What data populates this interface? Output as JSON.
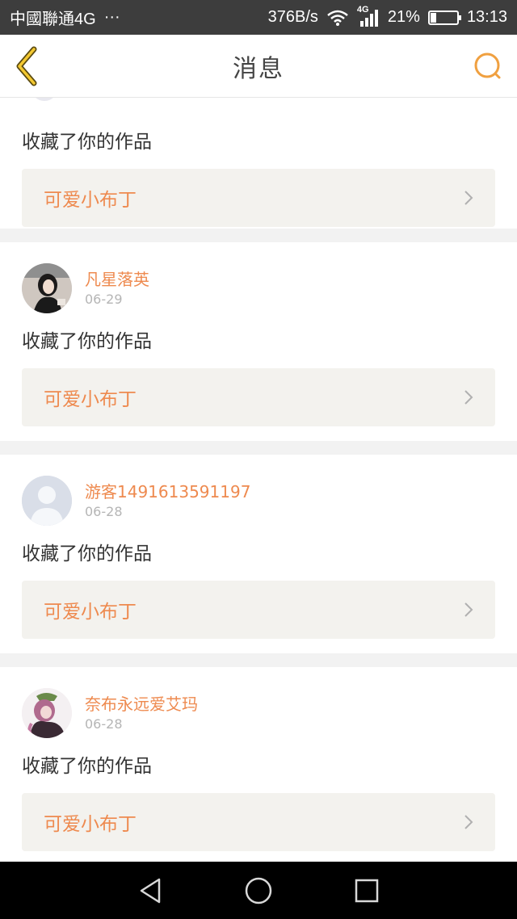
{
  "status_bar": {
    "carrier": "中國聯通4G",
    "more": "···",
    "net_speed": "376B/s",
    "signal_type": "4G",
    "battery": "21%",
    "battery_level": 0.21,
    "time": "13:13"
  },
  "header": {
    "title": "消息",
    "back_icon": "chevron-left-icon",
    "search_icon": "search-icon",
    "accent_color": "#f0a040"
  },
  "messages": [
    {
      "name": "",
      "date": "",
      "action": "收藏了你的作品",
      "work_title": "可爱小布丁",
      "partial": true
    },
    {
      "name": "凡星落英",
      "date": "06-29",
      "action": "收藏了你的作品",
      "work_title": "可爱小布丁",
      "avatar": "photo-avatar"
    },
    {
      "name": "游客1491613591197",
      "date": "06-28",
      "action": "收藏了你的作品",
      "work_title": "可爱小布丁",
      "avatar": "default-avatar"
    },
    {
      "name": "奈布永远爱艾玛",
      "date": "06-28",
      "action": "收藏了你的作品",
      "work_title": "可爱小布丁",
      "avatar": "anime-avatar"
    }
  ],
  "system_nav": {
    "back": "triangle-back-icon",
    "home": "circle-home-icon",
    "recents": "square-recents-icon"
  },
  "colors": {
    "name_color": "#ee8a4f",
    "work_box_bg": "#f3f2ee"
  }
}
